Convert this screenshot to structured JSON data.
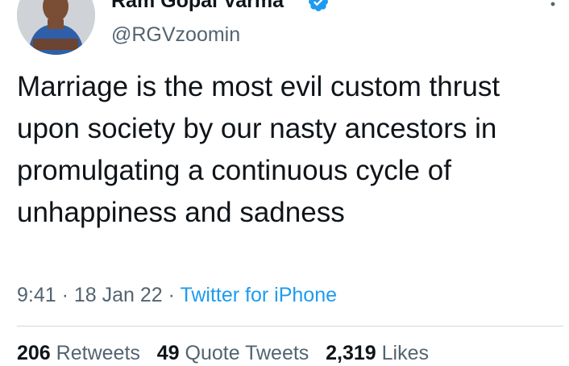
{
  "user": {
    "display_name": "Ram Gopal Varma",
    "handle": "@RGVzoomin",
    "verified_icon": "verified-badge-icon"
  },
  "tweet": {
    "text": "Marriage is the most evil custom thrust upon society by our nasty ancestors in promulgating a continuous cycle of unhappiness and sadness"
  },
  "meta": {
    "time": "9:41",
    "sep1": " · ",
    "date": "18 Jan 22",
    "sep2": " · ",
    "source": "Twitter for iPhone"
  },
  "stats": {
    "retweets_count": "206",
    "retweets_label": "Retweets",
    "quotes_count": "49",
    "quotes_label": "Quote Tweets",
    "likes_count": "2,319",
    "likes_label": "Likes"
  },
  "colors": {
    "accent": "#1d9bf0",
    "secondary_text": "#536471"
  }
}
